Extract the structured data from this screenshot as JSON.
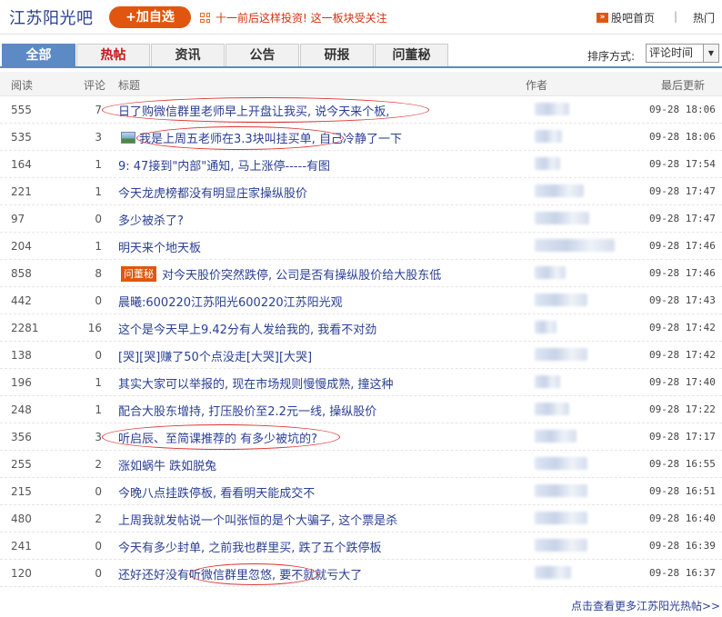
{
  "header": {
    "bar_name": "江苏阳光吧",
    "add_button": "+加自选",
    "notice": "十一前后这样投资! 这一板块受关注",
    "home_link": "股吧首页",
    "separator": "|",
    "hot_link": "热门"
  },
  "tabs": [
    {
      "label": "全部",
      "state": "active"
    },
    {
      "label": "热帖",
      "state": "hot"
    },
    {
      "label": "资讯",
      "state": "normal"
    },
    {
      "label": "公告",
      "state": "normal"
    },
    {
      "label": "研报",
      "state": "normal"
    },
    {
      "label": "问董秘",
      "state": "normal"
    }
  ],
  "sort": {
    "label": "排序方式:",
    "value": "评论时间",
    "arrow": "▼"
  },
  "columns": {
    "reads": "阅读",
    "comments": "评论",
    "title": "标题",
    "author": "作者",
    "updated": "最后更新"
  },
  "rows": [
    {
      "reads": "555",
      "comments": "7",
      "title": "日了购微信群里老师早上开盘让我买, 说今天来个板,",
      "time": "09-28 18:06"
    },
    {
      "reads": "535",
      "comments": "3",
      "title": "我是上周五老师在3.3块叫挂买单, 自己冷静了一下",
      "time": "09-28 18:06",
      "icon": "image-icon"
    },
    {
      "reads": "164",
      "comments": "1",
      "title": "9: 47接到\"内部\"通知, 马上涨停-----有图",
      "time": "09-28 17:54"
    },
    {
      "reads": "221",
      "comments": "1",
      "title": "今天龙虎榜都没有明显庄家操纵股价",
      "time": "09-28 17:47"
    },
    {
      "reads": "97",
      "comments": "0",
      "title": "多少被杀了?",
      "time": "09-28 17:47"
    },
    {
      "reads": "204",
      "comments": "1",
      "title": "明天来个地天板",
      "time": "09-28 17:46"
    },
    {
      "reads": "858",
      "comments": "8",
      "title": "对今天股价突然跌停, 公司是否有操纵股价给大股东低",
      "time": "09-28 17:46",
      "tag": "问董秘"
    },
    {
      "reads": "442",
      "comments": "0",
      "title": "晨曦:600220江苏阳光600220江苏阳光观",
      "time": "09-28 17:43"
    },
    {
      "reads": "2281",
      "comments": "16",
      "title": "这个是今天早上9.42分有人发给我的, 我看不对劲",
      "time": "09-28 17:42"
    },
    {
      "reads": "138",
      "comments": "0",
      "title": "[哭][哭]赚了50个点没走[大哭][大哭]",
      "time": "09-28 17:42"
    },
    {
      "reads": "196",
      "comments": "1",
      "title": "其实大家可以举报的, 现在市场规则慢慢成熟, 撞这种",
      "time": "09-28 17:40"
    },
    {
      "reads": "248",
      "comments": "1",
      "title": "配合大股东增持, 打压股价至2.2元一线, 操纵股价",
      "time": "09-28 17:22"
    },
    {
      "reads": "356",
      "comments": "3",
      "title": "听启辰、至简课推荐的 有多少被坑的?",
      "time": "09-28 17:17"
    },
    {
      "reads": "255",
      "comments": "2",
      "title": "涨如蜗牛 跌如脱兔",
      "time": "09-28 16:55"
    },
    {
      "reads": "215",
      "comments": "0",
      "title": "今晚八点挂跌停板, 看看明天能成交不",
      "time": "09-28 16:51"
    },
    {
      "reads": "480",
      "comments": "2",
      "title": "上周我就发帖说一个叫张恒的是个大骗子, 这个票是杀",
      "time": "09-28 16:40"
    },
    {
      "reads": "241",
      "comments": "0",
      "title": "今天有多少封单, 之前我也群里买, 跌了五个跌停板",
      "time": "09-28 16:39"
    },
    {
      "reads": "120",
      "comments": "0",
      "title": "还好还好没有听微信群里忽悠, 要不就就亏大了",
      "time": "09-28 16:37"
    }
  ],
  "footer": {
    "more_link": "点击查看更多江苏阳光热帖>>"
  },
  "colors": {
    "accent": "#e1560e",
    "link": "#2a3f94",
    "tab_active": "#5b8ac5",
    "annotation": "#dd3333"
  }
}
